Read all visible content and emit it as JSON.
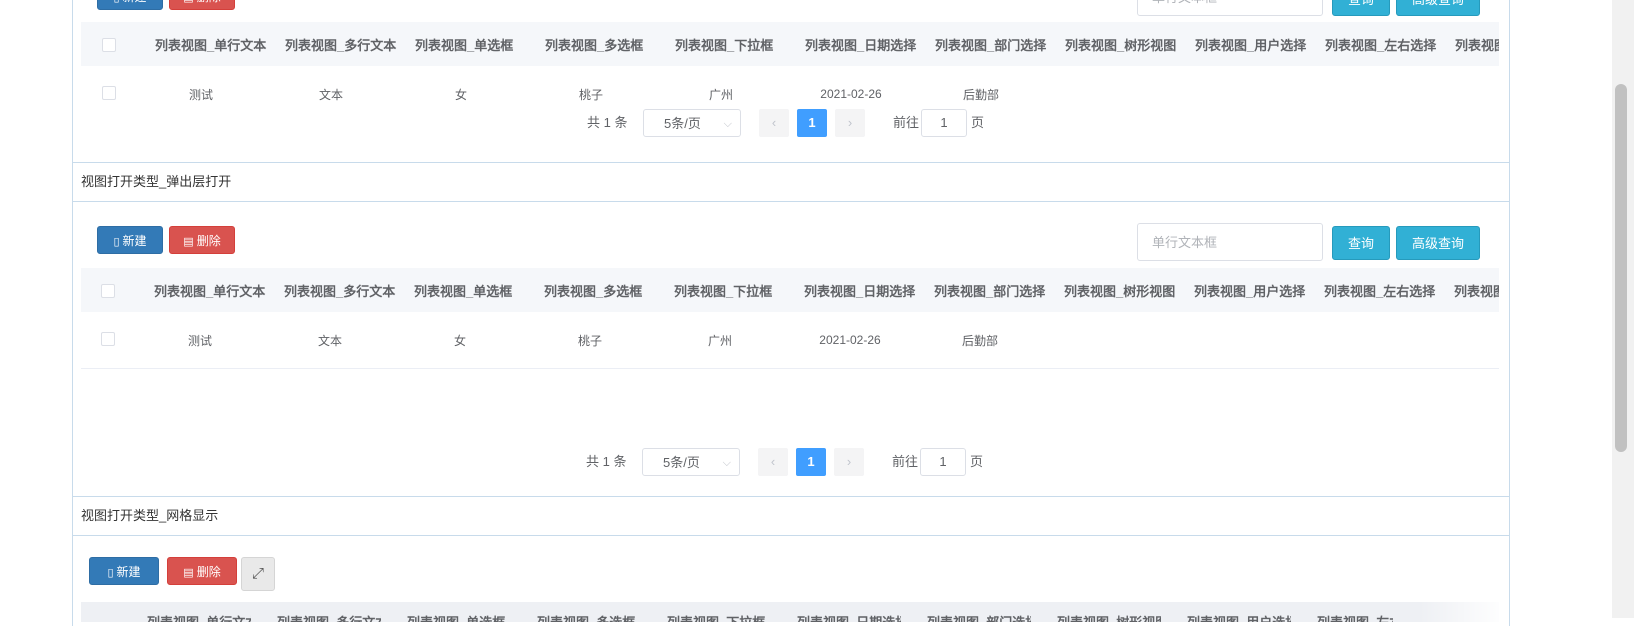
{
  "columns": [
    "列表视图_单行文本",
    "列表视图_多行文本",
    "列表视图_单选框",
    "列表视图_多选框",
    "列表视图_下拉框",
    "列表视图_日期选择",
    "列表视图_部门选择",
    "列表视图_树形视图",
    "列表视图_用户选择",
    "列表视图_左右选择",
    "列表视图"
  ],
  "row": [
    "测试",
    "文本",
    "女",
    "桃子",
    "广州",
    "2021-02-26",
    "后勤部"
  ],
  "toolbar": {
    "new_label": "新建",
    "delete_label": "删除",
    "search_placeholder": "单行文本框",
    "query_label": "查询",
    "advanced_query_label": "高级查询",
    "expand_icon": "expand-arrows-icon"
  },
  "pager": {
    "total_text": "共 1 条",
    "page_size_text": "5条/页",
    "current_page": "1",
    "goto_prefix": "前往",
    "goto_value": "1",
    "goto_suffix": "页"
  },
  "panels": {
    "popup_title": "视图打开类型_弹出层打开",
    "grid_title": "视图打开类型_网格显示"
  },
  "colors": {
    "new_button": "#337ab7",
    "delete_button": "#d9534f",
    "query_button": "#31b0d5",
    "active_page": "#409eff",
    "header_bg": "#f5f7fa",
    "panel_border": "#c8dbeb"
  }
}
